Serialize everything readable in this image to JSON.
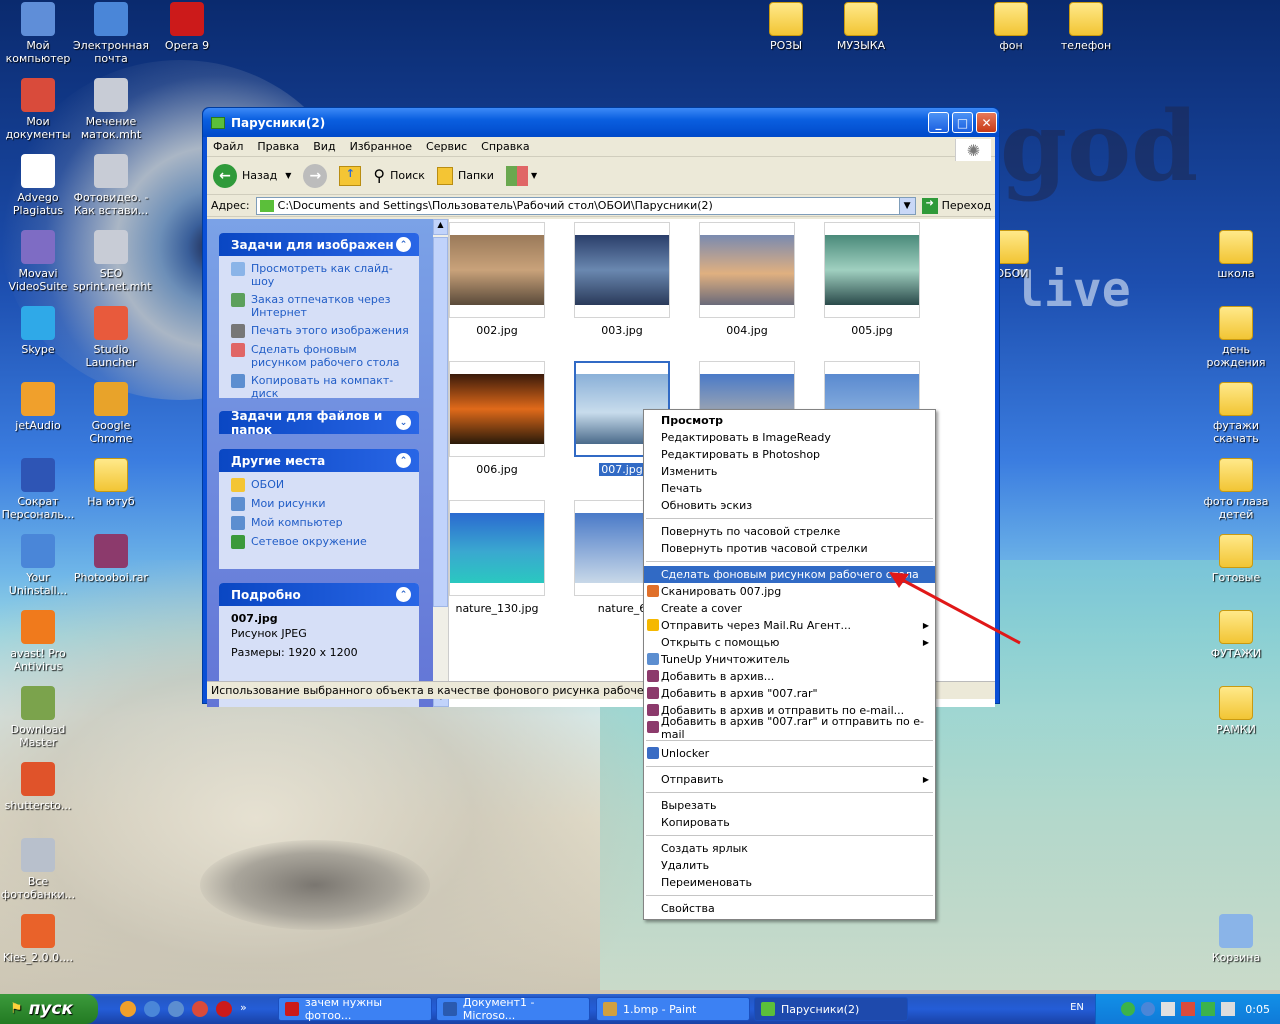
{
  "desktop_left": [
    {
      "label": "Мой компьютер",
      "color": "#5f8ed8"
    },
    {
      "label": "Мои документы",
      "color": "#d94b3b"
    },
    {
      "label": "Advego Plagiatus",
      "color": "#ffffff"
    },
    {
      "label": "Movavi VideoSuite",
      "color": "#7e6cc4"
    },
    {
      "label": "Skype",
      "color": "#2fa9e8"
    },
    {
      "label": "jetAudio",
      "color": "#f0a02c"
    },
    {
      "label": "Сократ Персональ...",
      "color": "#2e55b5"
    },
    {
      "label": "Your Uninstall...",
      "color": "#4a86d8"
    },
    {
      "label": "avast! Pro Antivirus",
      "color": "#f07a1c"
    },
    {
      "label": "Download Master",
      "color": "#7ba34c"
    },
    {
      "label": "shuttersto...",
      "color": "#e0532a"
    },
    {
      "label": "Все фотобанки...",
      "color": "#b8c0cc"
    },
    {
      "label": "Kies_2.0.0....",
      "color": "#e9622a"
    }
  ],
  "desktop_left2": [
    {
      "label": "Электронная почта",
      "color": "#4a86d8"
    },
    {
      "label": "Мечение маток.mht",
      "color": "#c8ccd6"
    },
    {
      "label": "Фотовидео. - Как встави...",
      "color": "#c8ccd6"
    },
    {
      "label": "SEO sprint.net.mht",
      "color": "#c8ccd6"
    },
    {
      "label": "Studio Launcher",
      "color": "#e85a3c"
    },
    {
      "label": "Google Chrome",
      "color": "#e8a32a"
    },
    {
      "label": "На ютуб",
      "color": "folder"
    },
    {
      "label": "Photooboi.rar",
      "color": "#8c3a6c"
    }
  ],
  "desktop_top": [
    {
      "label": "Opera 9"
    },
    {
      "label": "РОЗЫ"
    },
    {
      "label": "МУЗЫКА"
    },
    {
      "label": "фон"
    },
    {
      "label": "телефон"
    }
  ],
  "desktop_right": [
    {
      "label": "школа"
    },
    {
      "label": "день рождения"
    },
    {
      "label": "футажи скачать"
    },
    {
      "label": "фото глаза детей"
    },
    {
      "label": "Готовые"
    },
    {
      "label": "ФУТАЖИ"
    },
    {
      "label": "РАМКИ"
    },
    {
      "label": "Корзина"
    }
  ],
  "desktop_misc": {
    "oboi_label": "ОБОИ",
    "deco1": "god",
    "deco2": "e",
    "deco3": "live"
  },
  "window": {
    "title": "Парусники(2)",
    "menu": [
      "Файл",
      "Правка",
      "Вид",
      "Избранное",
      "Сервис",
      "Справка"
    ],
    "toolbar": {
      "back": "Назад",
      "search": "Поиск",
      "folders": "Папки"
    },
    "address_label": "Адрес:",
    "address": "C:\\Documents and Settings\\Пользователь\\Рабочий стол\\ОБОИ\\Парусники(2)",
    "go": "Переход",
    "status": "Использование выбранного объекта в качестве фонового рисунка рабочего стола."
  },
  "sidebar": {
    "image_tasks": {
      "title": "Задачи для изображен",
      "items": [
        "Просмотреть как слайд-шоу",
        "Заказ отпечатков через Интернет",
        "Печать этого изображения",
        "Сделать фоновым рисунком рабочего стола",
        "Копировать на компакт-диск"
      ]
    },
    "file_tasks": {
      "title": "Задачи для файлов и папок"
    },
    "other_places": {
      "title": "Другие места",
      "items": [
        "ОБОИ",
        "Мои рисунки",
        "Мой компьютер",
        "Сетевое окружение"
      ]
    },
    "details": {
      "title": "Подробно",
      "name": "007.jpg",
      "type": "Рисунок JPEG",
      "size": "Размеры: 1920 x 1200"
    }
  },
  "files": [
    "002.jpg",
    "003.jpg",
    "004.jpg",
    "005.jpg",
    "006.jpg",
    "007.jpg",
    "",
    "",
    "nature_130.jpg",
    "nature_6"
  ],
  "context_menu": [
    {
      "label": "Просмотр",
      "bold": true
    },
    {
      "label": "Редактировать в ImageReady"
    },
    {
      "label": "Редактировать в Photoshop"
    },
    {
      "label": "Изменить"
    },
    {
      "label": "Печать"
    },
    {
      "label": "Обновить эскиз"
    },
    {
      "sep": true
    },
    {
      "label": "Повернуть по часовой стрелке"
    },
    {
      "label": "Повернуть против часовой стрелки"
    },
    {
      "sep": true
    },
    {
      "label": "Сделать фоновым рисунком рабочего стола",
      "hl": true
    },
    {
      "label": "Сканировать 007.jpg",
      "icon": "#e0702a"
    },
    {
      "label": "Create a cover"
    },
    {
      "label": "Отправить через Mail.Ru Агент...",
      "icon": "#f5b800",
      "sub": true
    },
    {
      "label": "Открыть с помощью",
      "sub": true
    },
    {
      "label": "TuneUp Уничтожитель",
      "icon": "#5c8ed0"
    },
    {
      "label": "Добавить в архив...",
      "icon": "#8c3a6c"
    },
    {
      "label": "Добавить в архив \"007.rar\"",
      "icon": "#8c3a6c"
    },
    {
      "label": "Добавить в архив и отправить по e-mail...",
      "icon": "#8c3a6c"
    },
    {
      "label": "Добавить в архив \"007.rar\" и отправить по e-mail",
      "icon": "#8c3a6c"
    },
    {
      "sep": true
    },
    {
      "label": "Unlocker",
      "icon": "#3a6cc4"
    },
    {
      "sep": true
    },
    {
      "label": "Отправить",
      "sub": true
    },
    {
      "sep": true
    },
    {
      "label": "Вырезать"
    },
    {
      "label": "Копировать"
    },
    {
      "sep": true
    },
    {
      "label": "Создать ярлык"
    },
    {
      "label": "Удалить"
    },
    {
      "label": "Переименовать"
    },
    {
      "sep": true
    },
    {
      "label": "Свойства"
    }
  ],
  "taskbar": {
    "start": "пуск",
    "tasks": [
      "зачем нужны фотоо...",
      "Документ1 - Microso...",
      "1.bmp - Paint",
      "Парусники(2)"
    ],
    "lang": "EN",
    "clock": "0:05"
  }
}
